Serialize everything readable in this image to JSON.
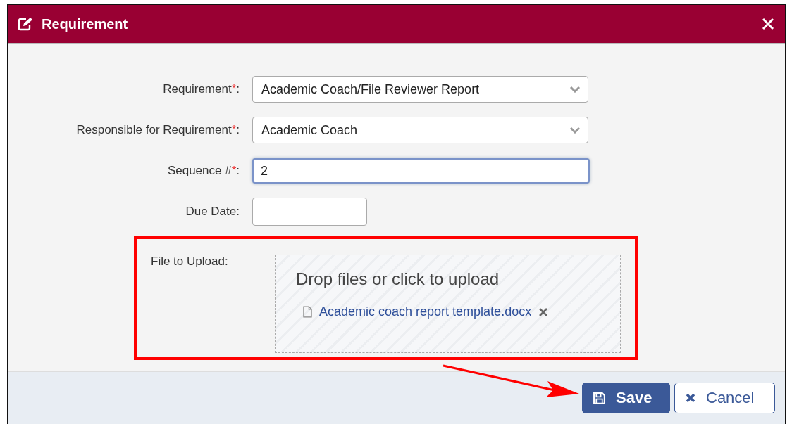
{
  "dialog": {
    "title": "Requirement"
  },
  "fields": [
    {
      "label": "Requirement",
      "required_mark": "*",
      "colon": ":",
      "kind": "select",
      "value": "Academic Coach/File Reviewer Report",
      "focused": false
    },
    {
      "label": "Responsible for Requirement",
      "required_mark": "*",
      "colon": ":",
      "kind": "select",
      "value": "Academic Coach",
      "focused": false
    },
    {
      "label": "Sequence #",
      "required_mark": "*",
      "colon": ":",
      "kind": "text",
      "value": "2",
      "focused": true
    },
    {
      "label": "Due Date",
      "colon": ":",
      "kind": "date",
      "focused": false
    }
  ],
  "upload": {
    "label": "File to Upload:",
    "prompt": "Drop files or click to upload",
    "files": [
      "Academic coach report template.docx"
    ],
    "highlighted": true
  },
  "buttons": [
    {
      "label": "Save",
      "kind": "primary"
    },
    {
      "label": "Cancel",
      "kind": "secondary"
    }
  ]
}
